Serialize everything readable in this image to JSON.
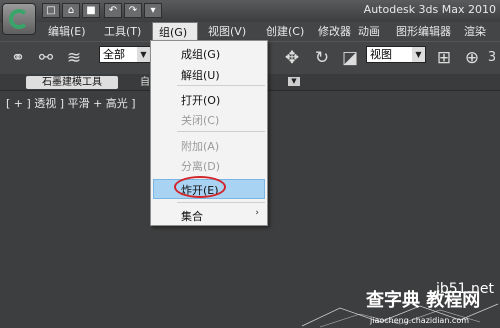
{
  "window": {
    "title": "Autodesk 3ds Max  2010"
  },
  "quick_access": [
    "new-file",
    "open-file",
    "save-file",
    "undo",
    "redo",
    "more"
  ],
  "menubar": {
    "items": [
      {
        "label": "编辑(E)"
      },
      {
        "label": "工具(T)"
      },
      {
        "label": "组(G)",
        "active": true
      },
      {
        "label": "视图(V)"
      },
      {
        "label": "创建(C)"
      },
      {
        "label": "修改器"
      },
      {
        "label": "动画"
      },
      {
        "label": "图形编辑器"
      },
      {
        "label": "渲染(R)"
      }
    ]
  },
  "toolbar": {
    "selection_filter": "全部",
    "coordinate_system": "视图",
    "number": "3"
  },
  "ribbon": {
    "tab1": "石墨建模工具",
    "tab2": "自"
  },
  "viewport": {
    "label": "[ + ] 透视 ] 平滑 + 高光 ]"
  },
  "group_menu": {
    "items": [
      {
        "label": "成组(G)",
        "enabled": true
      },
      {
        "label": "解组(U)",
        "enabled": true
      },
      {
        "label": "打开(O)",
        "enabled": true
      },
      {
        "label": "关闭(C)",
        "enabled": false
      },
      {
        "label": "附加(A)",
        "enabled": false
      },
      {
        "label": "分离(D)",
        "enabled": false
      },
      {
        "label": "炸开(E)",
        "enabled": true,
        "highlighted": true
      },
      {
        "label": "集合",
        "enabled": true,
        "submenu": true
      }
    ]
  },
  "watermark": {
    "main": "查字典 教程网",
    "sub": "jb51.net",
    "url": "jiaocheng.chazidian.com"
  }
}
